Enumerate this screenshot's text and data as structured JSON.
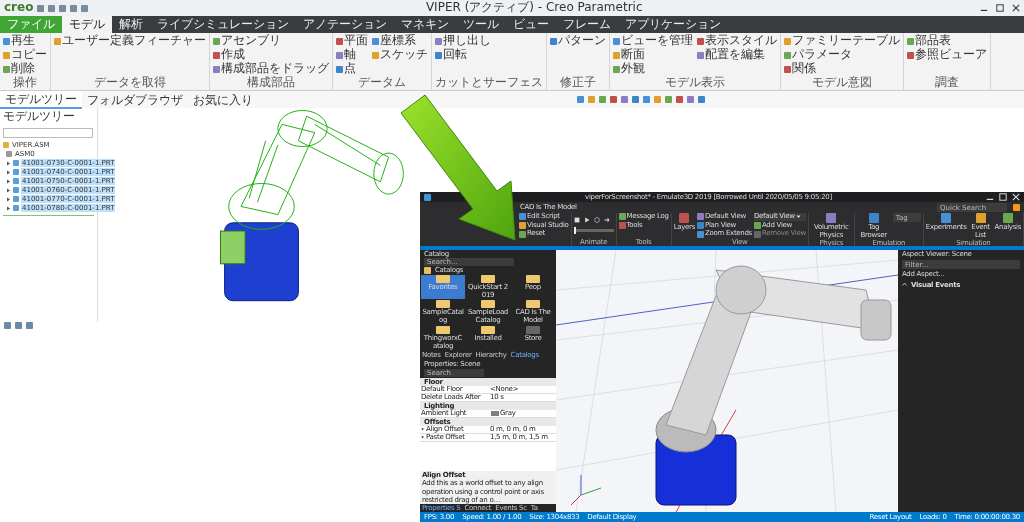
{
  "creo": {
    "logo": "creo",
    "title": "VIPER (アクティブ) - Creo Parametric",
    "tabs": [
      {
        "label": "ファイル",
        "kind": "file",
        "selected": false
      },
      {
        "label": "モデル",
        "kind": "tab",
        "selected": true
      },
      {
        "label": "解析",
        "kind": "tab",
        "selected": false
      },
      {
        "label": "ライブシミュレーション",
        "kind": "tab",
        "selected": false
      },
      {
        "label": "アノテーション",
        "kind": "tab",
        "selected": false
      },
      {
        "label": "マネキン",
        "kind": "tab",
        "selected": false
      },
      {
        "label": "ツール",
        "kind": "tab",
        "selected": false
      },
      {
        "label": "ビュー",
        "kind": "tab",
        "selected": false
      },
      {
        "label": "フレーム",
        "kind": "tab",
        "selected": false
      },
      {
        "label": "アプリケーション",
        "kind": "tab",
        "selected": false
      }
    ],
    "ribbon_groups": [
      {
        "label": "操作",
        "buttons": [
          "再生",
          "コピー",
          "削除"
        ]
      },
      {
        "label": "データを取得",
        "buttons": [
          "ユーザー定義フィーチャー"
        ]
      },
      {
        "label": "構成部品",
        "buttons": [
          "アセンブリ",
          "作成",
          "構成部品をドラッグ"
        ]
      },
      {
        "label": "データム",
        "buttons": [
          "平面",
          "軸",
          "点",
          "座標系",
          "スケッチ"
        ]
      },
      {
        "label": "カットとサーフェス",
        "buttons": [
          "押し出し",
          "回転"
        ]
      },
      {
        "label": "修正子",
        "buttons": [
          "パターン"
        ]
      },
      {
        "label": "モデル表示",
        "buttons": [
          "ビューを管理",
          "断面",
          "外観",
          "表示スタイル",
          "配置を編集"
        ]
      },
      {
        "label": "モデル意図",
        "buttons": [
          "ファミリーテーブル",
          "パラメータ",
          "関係"
        ]
      },
      {
        "label": "調査",
        "buttons": [
          "部品表",
          "参照ビューア"
        ]
      }
    ],
    "tree_tabs": [
      {
        "label": "モデルツリー",
        "selected": true
      },
      {
        "label": "フォルダブラウザ",
        "selected": false
      },
      {
        "label": "お気に入り",
        "selected": false
      }
    ],
    "tree_header": "モデルツリー",
    "tree": [
      {
        "label": "VIPER.ASM",
        "kind": "assembly",
        "selected": false,
        "children": [
          {
            "label": "ASM0",
            "kind": "csys",
            "selected": false
          },
          {
            "label": "41001-0730-C-0001-1.PRT",
            "kind": "part",
            "selected": true
          },
          {
            "label": "41001-0740-C-0001-1.PRT",
            "kind": "part",
            "selected": true
          },
          {
            "label": "41001-0750-C-0001-1.PRT",
            "kind": "part",
            "selected": true
          },
          {
            "label": "41001-0760-C-0001-1.PRT",
            "kind": "part",
            "selected": true
          },
          {
            "label": "41001-0770-C-0001-1.PRT",
            "kind": "part",
            "selected": true
          },
          {
            "label": "41001-0780-C-0001-1.PRT",
            "kind": "part",
            "selected": true
          }
        ]
      }
    ]
  },
  "emulate": {
    "title": "viperForScreenshot* - Emulate3D 2019 [Borrowed Until 2020/05/05 9:05:20]",
    "context_tab": "CAD Is The Model",
    "quick_search": {
      "placeholder": "Quick Search"
    },
    "ribbon_groups": [
      {
        "buttons": [
          {
            "label": "Edit Script",
            "kind": "small"
          },
          {
            "label": "Visual Studio",
            "kind": "small"
          },
          {
            "label": "Reset",
            "kind": "small"
          }
        ]
      },
      {
        "label": "Animate",
        "buttons": [
          {
            "kind": "transport",
            "level": 0.02
          }
        ]
      },
      {
        "label": "Tools",
        "buttons": [
          {
            "label": "Message Log",
            "kind": "small"
          },
          {
            "label": "Tools",
            "kind": "small"
          }
        ]
      },
      {
        "label": "View",
        "buttons": [
          {
            "label": "Layers",
            "kind": "large"
          },
          {
            "label": "Default View",
            "kind": "small"
          },
          {
            "label": "Plan View",
            "kind": "small"
          },
          {
            "label": "Zoom Extends",
            "kind": "small"
          },
          {
            "label": "Default View",
            "kind": "dropdown"
          },
          {
            "label": "Add View",
            "kind": "small"
          },
          {
            "label": "Remove View",
            "kind": "disabled"
          }
        ]
      },
      {
        "label": "Physics",
        "buttons": [
          {
            "label": "Volumetric Physics",
            "kind": "large"
          }
        ]
      },
      {
        "label": "Emulation",
        "buttons": [
          {
            "label": "Tag Browser",
            "kind": "large"
          },
          {
            "placeholder": "Tag",
            "kind": "field"
          }
        ]
      },
      {
        "label": "Simulation",
        "buttons": [
          {
            "label": "Experiments",
            "kind": "large"
          },
          {
            "label": "Event List",
            "kind": "large"
          },
          {
            "label": "Analysis",
            "kind": "large"
          }
        ]
      }
    ],
    "catalog": {
      "title": "Catalog",
      "search": {
        "placeholder": "Search..."
      },
      "breadcrumb": "Catalogs",
      "items": [
        {
          "label": "Favorites",
          "kind": "folder",
          "selected": true
        },
        {
          "label": "QuickStart 2019",
          "kind": "folder",
          "selected": false
        },
        {
          "label": "Peop",
          "kind": "folder",
          "selected": false
        },
        {
          "label": "SampleCatalog",
          "kind": "folder",
          "selected": false
        },
        {
          "label": "SampleLoadCatalog",
          "kind": "folder",
          "selected": false
        },
        {
          "label": "CAD Is The Model",
          "kind": "folder",
          "selected": false
        },
        {
          "label": "ThingworxCatalog",
          "kind": "folder",
          "selected": false
        },
        {
          "label": "Installed",
          "kind": "folder",
          "selected": false
        },
        {
          "label": "Store",
          "kind": "store",
          "selected": false
        }
      ]
    },
    "panel_tabs": [
      {
        "label": "Notes",
        "selected": false
      },
      {
        "label": "Explorer",
        "selected": false
      },
      {
        "label": "Hierarchy",
        "selected": false
      },
      {
        "label": "Catalogs",
        "selected": true
      }
    ],
    "properties": {
      "title": "Properties: Scene",
      "search": {
        "placeholder": "Search"
      },
      "categories": [
        {
          "label": "Floor",
          "rows": [
            {
              "name": "Default Floor",
              "value": "<None>",
              "kind": "text"
            },
            {
              "name": "Delete Loads After",
              "value": "10 s",
              "kind": "text"
            }
          ]
        },
        {
          "label": "Lighting",
          "rows": [
            {
              "name": "Ambient Light",
              "value": "Gray",
              "kind": "color"
            }
          ]
        },
        {
          "label": "Offsets",
          "rows": [
            {
              "name": "Align Offset",
              "value": "0 m, 0 m, 0 m",
              "kind": "vector"
            },
            {
              "name": "Paste Offset",
              "value": "1,5 m, 0 m, 1,5 m",
              "kind": "vector"
            }
          ]
        }
      ],
      "help_title": "Align Offset",
      "help_text": "Add this as a world offset to any align operation using a control point or axis restricted drag of an o…"
    },
    "bottom_tabs": [
      {
        "label": "Properties S",
        "selected": true
      },
      {
        "label": "Connect",
        "selected": false
      },
      {
        "label": "Events Sc",
        "selected": false
      },
      {
        "label": "Ta",
        "selected": false
      }
    ],
    "aspect": {
      "title": "Aspect Viewer: Scene",
      "filter": {
        "placeholder": "Filter..."
      },
      "add": "Add Aspect...",
      "section": "Visual Events"
    },
    "status_left": [
      "FPS: 3.00",
      "Speed: 1.00 / 1.00",
      "Size: 1304x833",
      "Default Display"
    ],
    "status_right": [
      "Reset Layout",
      "Loads: 0",
      "Time: 0:00:00:00.30"
    ]
  }
}
